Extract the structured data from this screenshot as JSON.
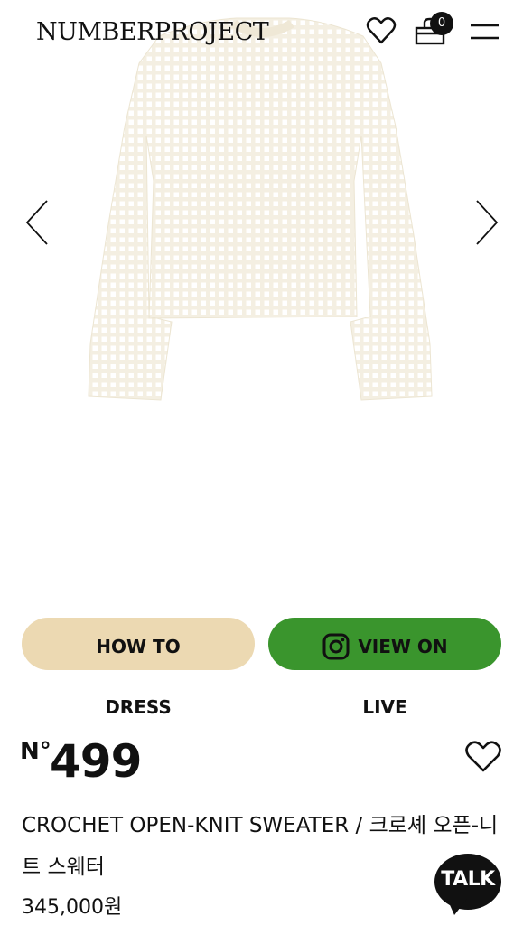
{
  "header": {
    "logo": "NUMBERPROJECT",
    "cart_count": "0",
    "icons": [
      "heart-icon",
      "shopping-bag-icon",
      "menu-icon"
    ]
  },
  "gallery": {
    "product_image": "cream crochet open-knit sweater",
    "prev_icon": "chevron-left-icon",
    "next_icon": "chevron-right-icon"
  },
  "actions": {
    "howto_label": "HOW TO",
    "howto_sub": "DRESS",
    "live_label": "VIEW ON",
    "live_sub": "LIVE",
    "live_icon": "instagram-icon",
    "howto_color": "#ecd9b2",
    "live_color": "#3a952d"
  },
  "product": {
    "number_prefix": "N°",
    "number": "499",
    "title": "CROCHET OPEN-KNIT SWEATER / 크로셰 오픈-니트 스웨터",
    "price": "345,000원"
  },
  "chat": {
    "label": "TALK"
  }
}
